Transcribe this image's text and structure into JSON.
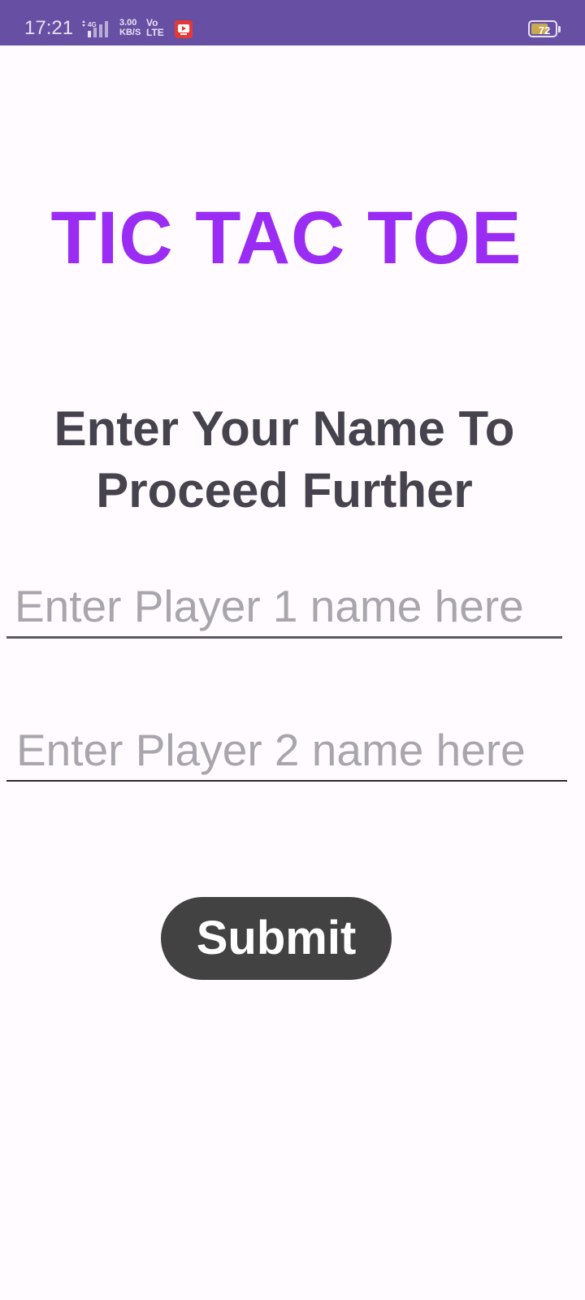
{
  "status_bar": {
    "time": "17:21",
    "network_type": "4G",
    "speed_value": "3.00",
    "speed_unit": "KB/S",
    "volte_top": "Vo",
    "volte_bottom": "LTE",
    "battery_level": "72",
    "battery_fraction": 0.72,
    "background_color": "#6750a4"
  },
  "title": "TIC TAC TOE",
  "prompt": "Enter Your Name To Proceed Further",
  "player1": {
    "placeholder": "Enter Player 1 name here",
    "value": ""
  },
  "player2": {
    "placeholder": "Enter Player 2 name here",
    "value": ""
  },
  "submit_label": "Submit",
  "colors": {
    "title": "#9b2cf3",
    "prompt": "#45434d",
    "button": "#424242",
    "background": "#fffbfe"
  }
}
